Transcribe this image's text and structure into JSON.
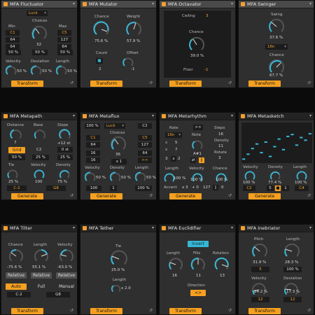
{
  "colors": {
    "accent": "#f5a020",
    "knob": "#37b6d6",
    "panel": "#2f2f2f"
  },
  "fluctuator": {
    "title": "MFA Fluctuator",
    "mode": "Luck",
    "min_label": "Min",
    "choices_label": "Choices",
    "max_label": "Max",
    "min_vals": [
      "C1",
      "64",
      "64"
    ],
    "max_vals": [
      "C5",
      "127",
      "64"
    ],
    "choices_val": "32",
    "pct_row": [
      "50 %",
      "50 %",
      "50 %"
    ],
    "vel_label": "Velocity",
    "vel_val": "50 %",
    "dev_label": "Deviation",
    "dev_val": "50 %",
    "len_label": "Length",
    "len_val": "50 %",
    "transform": "Transform"
  },
  "mutator": {
    "title": "MFA Mutator",
    "chance_label": "Chance",
    "chance_val": "75.6 %",
    "weight_label": "Weight",
    "weight_val": "57.9 %",
    "count_label": "Count",
    "count_val": "2",
    "offset_label": "Offset",
    "offset_val": "-1",
    "transform": "Transform"
  },
  "octavator": {
    "title": "MFA Octavator",
    "ceiling_label": "Ceiling",
    "ceiling_val": "3",
    "chance_label": "Chance",
    "chance_val": "39.0 %",
    "floor_label": "Floor",
    "floor_val": "-1",
    "transform": "Transform"
  },
  "swinger": {
    "title": "MFA Swinger",
    "swing_label": "Swing",
    "swing_val": "37.6 %",
    "grid_val": "16n",
    "chance_label": "Chance",
    "chance_val": "67.7 %",
    "transform": "Transform"
  },
  "metapath": {
    "title": "MFA Metapath",
    "distance_label": "Distance",
    "distance_val": "7",
    "base_label": "Base",
    "base_val": "C2",
    "slope_label": "Slope",
    "slope_val": "+12 st",
    "grid_btn": "Grid",
    "row2": [
      "50 %",
      "25 %",
      "0 st"
    ],
    "tie_label": "Tie",
    "tie_val": "25 %",
    "vel_label": "Velocity",
    "vel_val": "100",
    "den_label": "Density",
    "den_val": "75 %",
    "low_val": "C-2",
    "high_val": "G8",
    "generate": "Generate"
  },
  "metaflux": {
    "title": "MFA Metaflux",
    "pct": "100 %",
    "mode": "Luck",
    "note_val": "C2",
    "choices_label": "Choices",
    "c_left": [
      "C1",
      "64",
      "16",
      "16"
    ],
    "c_right": [
      "C5",
      "127",
      "64",
      ">>"
    ],
    "choices_val": "36",
    "x1": "x 1",
    "vel_label": "Velocity",
    "vel_val": "50 %",
    "den_label": "Density",
    "den_val": "50 %",
    "len_label": "Length",
    "len_val": "50 %",
    "bottom": [
      "100",
      "1",
      "100 %"
    ],
    "generate": "Generate"
  },
  "metarhythm": {
    "title": "MFA Metarhythm",
    "rate_label": "Rate",
    "rate_val": "16n",
    "x_vals": [
      "5",
      "7",
      "2"
    ],
    "note_label": "Note",
    "note_val": "A#1",
    "steps_label": "Steps",
    "steps_val": "16",
    "density_label": "Density",
    "density_val": "11",
    "rotate_label": "Rotate",
    "rotate_val": "3",
    "len_label": "Length",
    "len_val": "100 %",
    "vel_label": "Velocity",
    "vel_val": "100 %",
    "chance_label": "Chance",
    "chance_val": "100 %",
    "accent_label": "Accent",
    "accent_x": "x 3",
    "accent_plus": "+ 0",
    "accent_v": "127",
    "accent_o": "0",
    "generate": "Generate"
  },
  "metasketch": {
    "title": "MFA Metasketch",
    "vel_label": "Velocity",
    "vel_val": "100 %",
    "den_label": "Density",
    "den_val": "77.4 %",
    "len_label": "Length",
    "len_val": "100 %",
    "low_val": "C2",
    "high_val": "C4",
    "nums": [
      "5",
      "1"
    ],
    "generate": "Generate",
    "steps": [
      0.05,
      0.18,
      0.33,
      0.45,
      0.22,
      0.5,
      0.12,
      0.38,
      0.58,
      0.3,
      0.65,
      0.7,
      0.42,
      0.62,
      0.55,
      0.72
    ]
  },
  "tilter": {
    "title": "MFA Tilter",
    "chance_label": "Chance",
    "chance_val": "-75.6 %",
    "len_label": "Length",
    "len_val": "55.1 %",
    "vel_label": "Velocity",
    "vel_val": "-63.0 %",
    "rel": [
      "Relative",
      "Relative",
      "Relative"
    ],
    "modes": [
      "Auto",
      "Full",
      "Manual"
    ],
    "low_val": "C-2",
    "high_val": "G8",
    "transform": "Transform"
  },
  "tether": {
    "title": "MFA Tether",
    "tie_label": "Tie",
    "tie_val": "25.0 %",
    "len_label": "Length",
    "len_val": "x 2.0",
    "transform": "Transform"
  },
  "euclidifier": {
    "title": "MFA Euclidifier",
    "invert": "Invert",
    "len_label": "Length",
    "len_val": "16",
    "fills_label": "Fills",
    "fills_val": "11",
    "rot_label": "Rotation",
    "rot_val": "13",
    "dir_label": "Direction",
    "dir_val": "<>",
    "transform": "Transform"
  },
  "inebriator": {
    "title": "MFA Inebriator",
    "pitch_label": "Pitch",
    "pitch_val": "31.9 %",
    "pitch_num": "5",
    "len_label": "Length",
    "len_val": "28.3 %",
    "len_pct": "100 %",
    "vel_label": "Velocity",
    "vel_val": "14.2 %",
    "vel_num": "12",
    "dev_label": "Deviation",
    "dev_val": "17.3 %",
    "dev_num": "12",
    "transform": "Transform"
  }
}
